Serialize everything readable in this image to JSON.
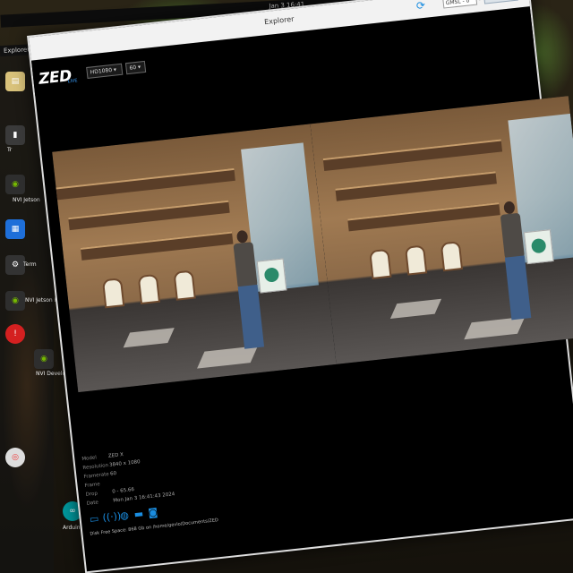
{
  "topbar": {
    "clock": "Jan 3  16:41"
  },
  "app_menu": {
    "label": "Explorer ▾"
  },
  "dock": {
    "items": [
      {
        "icon": "files-icon",
        "label": ""
      },
      {
        "icon": "terminal-icon",
        "label": "Tr"
      },
      {
        "icon": "nvidia-jetson-icon",
        "label": "NVI Jetson"
      },
      {
        "icon": "apps-icon",
        "label": ""
      },
      {
        "icon": "tool-icon",
        "label": "Term"
      },
      {
        "icon": "nvidia-jetson-icon",
        "label": "NVI Jetson Foru"
      },
      {
        "icon": "alert-icon",
        "label": ""
      },
      {
        "icon": "nvidia-icon",
        "label": "NVI Develop"
      },
      {
        "icon": "chrome-icon",
        "label": ""
      },
      {
        "icon": "arduino-icon",
        "label": "Arduino I"
      }
    ]
  },
  "window": {
    "title": "Explorer",
    "camera_select": "GMSL - 0",
    "sn_label": "SN",
    "sn_placeholder": "#470956",
    "logo": "ZED",
    "logo_sub": "LIVE",
    "resolution": "HD1080",
    "fps": "60"
  },
  "info": {
    "rows": [
      {
        "k": "Model",
        "v": "ZED X"
      },
      {
        "k": "Resolution",
        "v": "3840 x 1080"
      },
      {
        "k": "Framerate",
        "v": "60"
      },
      {
        "k": "Frame Drop",
        "v": "0 - 65.66"
      },
      {
        "k": "Date",
        "v": "Mon Jan 3 16:41:43 2024"
      }
    ]
  },
  "status": {
    "text": "Disk Free Space: 868 Gb on /home/gevlo/Documents/ZED"
  },
  "colors": {
    "accent": "#1a8de0",
    "window_bg": "#000000",
    "titlebar": "#f2f2f2"
  }
}
